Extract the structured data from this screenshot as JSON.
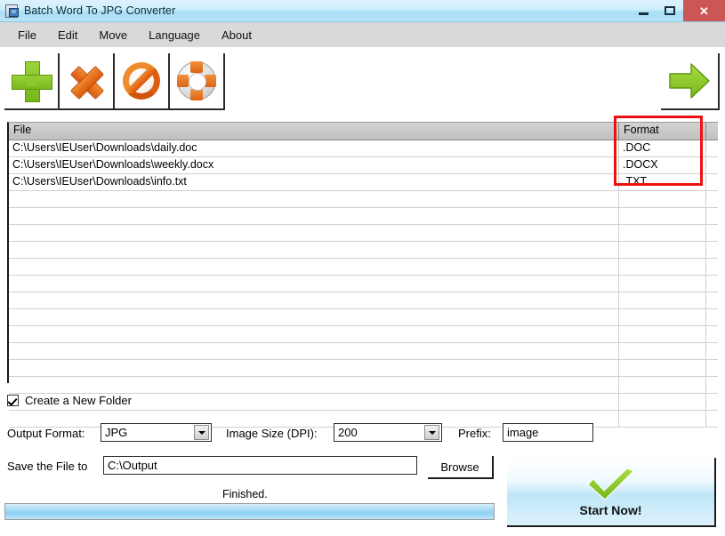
{
  "window": {
    "title": "Batch Word To JPG Converter",
    "icon": "app-document-icon",
    "controls": {
      "minimize": "minimize-icon",
      "maximize": "maximize-icon",
      "close": "close-icon"
    }
  },
  "menu": {
    "items": [
      {
        "label": "File"
      },
      {
        "label": "Edit"
      },
      {
        "label": "Move"
      },
      {
        "label": "Language"
      },
      {
        "label": "About"
      }
    ]
  },
  "toolbar": {
    "buttons": [
      {
        "name": "add-files-button",
        "icon": "plus-icon"
      },
      {
        "name": "remove-file-button",
        "icon": "cross-icon"
      },
      {
        "name": "clear-list-button",
        "icon": "ban-icon"
      },
      {
        "name": "help-button",
        "icon": "lifebuoy-icon"
      },
      {
        "name": "convert-button",
        "icon": "green-right-arrow-icon"
      }
    ]
  },
  "file_list": {
    "columns": [
      "File",
      "Format"
    ],
    "rows": [
      {
        "file": "C:\\Users\\IEUser\\Downloads\\daily.doc",
        "format": ".DOC"
      },
      {
        "file": "C:\\Users\\IEUser\\Downloads\\weekly.docx",
        "format": ".DOCX"
      },
      {
        "file": "C:\\Users\\IEUser\\Downloads\\info.txt",
        "format": ".TXT"
      }
    ],
    "empty_row_count": 13,
    "highlight": {
      "target": "format-column",
      "color": "#ee1111"
    }
  },
  "options": {
    "create_folder": {
      "label": "Create a New Folder",
      "checked": true
    },
    "output_format": {
      "label": "Output Format:",
      "value": "JPG"
    },
    "image_size": {
      "label": "Image Size (DPI):",
      "value": "200"
    },
    "prefix": {
      "label": "Prefix:",
      "value": "image"
    },
    "save_to": {
      "label": "Save the File to",
      "value": "C:\\Output"
    },
    "browse_label": "Browse"
  },
  "status": {
    "text": "Finished.",
    "progress_percent": 100
  },
  "start_button": {
    "label": "Start Now!",
    "icon": "green-check-icon"
  }
}
